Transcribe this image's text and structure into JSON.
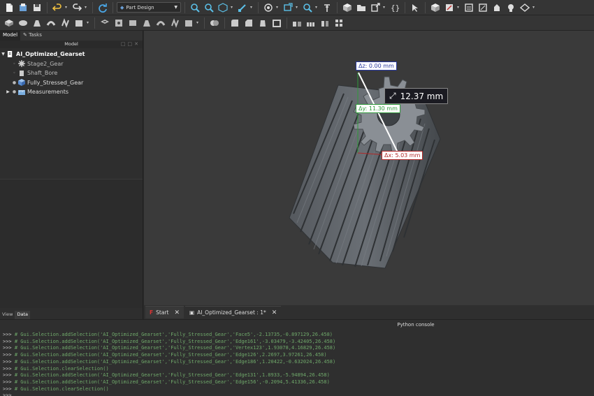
{
  "toolbar": {
    "workbench": "Part Design"
  },
  "left_panel": {
    "tabs": [
      "Model",
      "Tasks"
    ],
    "title": "Model",
    "tree": {
      "root": "AI_Optimized_Gearset",
      "items": [
        {
          "label": "Stage2_Gear"
        },
        {
          "label": "Shaft_Bore"
        },
        {
          "label": "Fully_Stressed_Gear"
        },
        {
          "label": "Measurements"
        }
      ]
    },
    "bottom_tabs": [
      "View",
      "Data"
    ]
  },
  "measurements": {
    "dz": "Δz: 0.00 mm",
    "dy": "Δy: 11.30 mm",
    "dx": "Δx: 5.03 mm",
    "distance": "12.37 mm"
  },
  "doc_tabs": [
    "Start",
    "AI_Optimized_Gearset : 1*"
  ],
  "console": {
    "title": "Python console",
    "prompt": ">>>",
    "lines": [
      "# Gui.Selection.addSelection('AI_Optimized_Gearset','Fully_Stressed_Gear','Face5',-2.13735,-0.897129,26.458)",
      "# Gui.Selection.addSelection('AI_Optimized_Gearset','Fully_Stressed_Gear','Edge161',-3.03479,-3.42405,26.458)",
      "# Gui.Selection.addSelection('AI_Optimized_Gearset','Fully_Stressed_Gear','Vertex123',1.93078,4.16829,26.458)",
      "# Gui.Selection.addSelection('AI_Optimized_Gearset','Fully_Stressed_Gear','Edge126',2.2697,3.97261,26.458)",
      "# Gui.Selection.addSelection('AI_Optimized_Gearset','Fully_Stressed_Gear','Edge186',1.20422,-0.632024,26.458)",
      "# Gui.Selection.clearSelection()",
      "# Gui.Selection.addSelection('AI_Optimized_Gearset','Fully_Stressed_Gear','Edge131',1.8933,-5.94894,26.458)",
      "# Gui.Selection.addSelection('AI_Optimized_Gearset','Fully_Stressed_Gear','Edge156',-0.2094,5.41336,26.458)",
      "# Gui.Selection.clearSelection()",
      ""
    ]
  }
}
